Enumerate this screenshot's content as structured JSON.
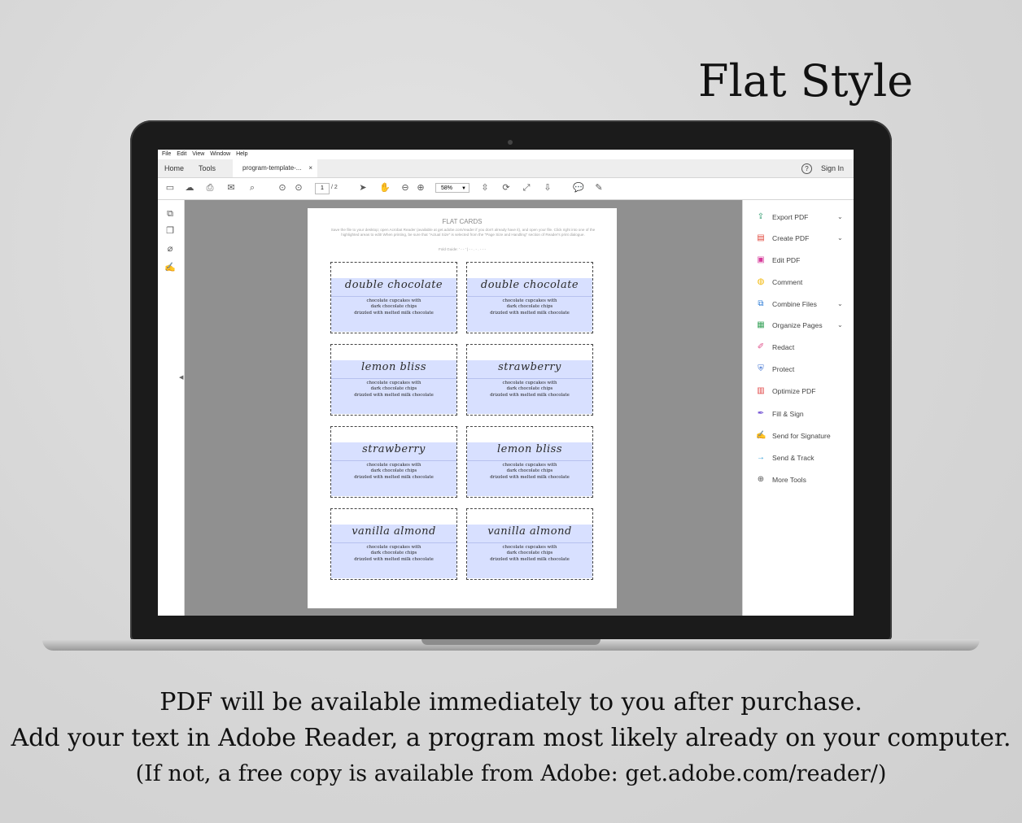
{
  "headline": "Flat Style",
  "menu": [
    "File",
    "Edit",
    "View",
    "Window",
    "Help"
  ],
  "tabs": {
    "home": "Home",
    "tools": "Tools",
    "document": "program-template-...",
    "close": "×"
  },
  "help_icon": "?",
  "sign_in": "Sign In",
  "toolbar": {
    "page_current": "1",
    "page_total": "/ 2",
    "zoom": "58%"
  },
  "document": {
    "title": "FLAT CARDS",
    "instructions": "Save the file to your desktop; open Acrobat Reader (available at get.adobe.com/reader if you don't already have it), and open your file. Click right into one of the highlighted areas to edit! When printing, be sure that \"Actual Size\" is selected from the \"Page Size and Handling\" section of Reader's print dialogue.",
    "fold_guide": "Fold Guide: ' - - ' | - - . - . - - -",
    "cards": [
      {
        "name": "double chocolate",
        "line1": "chocolate cupcakes with",
        "line2": "dark chocolate chips",
        "line3": "drizzled with melted milk chocolate"
      },
      {
        "name": "double chocolate",
        "line1": "chocolate cupcakes with",
        "line2": "dark chocolate chips",
        "line3": "drizzled with melted milk chocolate"
      },
      {
        "name": "lemon bliss",
        "line1": "chocolate cupcakes with",
        "line2": "dark chocolate chips",
        "line3": "drizzled with melted milk chocolate"
      },
      {
        "name": "strawberry",
        "line1": "chocolate cupcakes with",
        "line2": "dark chocolate chips",
        "line3": "drizzled with melted milk chocolate"
      },
      {
        "name": "strawberry",
        "line1": "chocolate cupcakes with",
        "line2": "dark chocolate chips",
        "line3": "drizzled with melted milk chocolate"
      },
      {
        "name": "lemon bliss",
        "line1": "chocolate cupcakes with",
        "line2": "dark chocolate chips",
        "line3": "drizzled with melted milk chocolate"
      },
      {
        "name": "vanilla almond",
        "line1": "chocolate cupcakes with",
        "line2": "dark chocolate chips",
        "line3": "drizzled with melted milk chocolate"
      },
      {
        "name": "vanilla almond",
        "line1": "chocolate cupcakes with",
        "line2": "dark chocolate chips",
        "line3": "drizzled with melted milk chocolate"
      }
    ]
  },
  "tools_panel": [
    {
      "label": "Export PDF",
      "icon": "export-pdf-icon",
      "color": "#2e9b6e",
      "dropdown": true
    },
    {
      "label": "Create PDF",
      "icon": "create-pdf-icon",
      "color": "#e0463a",
      "dropdown": true
    },
    {
      "label": "Edit PDF",
      "icon": "edit-pdf-icon",
      "color": "#d63a9a",
      "dropdown": false
    },
    {
      "label": "Comment",
      "icon": "comment-icon",
      "color": "#f2b600",
      "dropdown": false
    },
    {
      "label": "Combine Files",
      "icon": "combine-files-icon",
      "color": "#2a7ad6",
      "dropdown": true
    },
    {
      "label": "Organize Pages",
      "icon": "organize-pages-icon",
      "color": "#3aa35b",
      "dropdown": true
    },
    {
      "label": "Redact",
      "icon": "redact-icon",
      "color": "#e0508a",
      "dropdown": false
    },
    {
      "label": "Protect",
      "icon": "protect-icon",
      "color": "#3a6fd0",
      "dropdown": false
    },
    {
      "label": "Optimize PDF",
      "icon": "optimize-pdf-icon",
      "color": "#e04040",
      "dropdown": false
    },
    {
      "label": "Fill & Sign",
      "icon": "fill-sign-icon",
      "color": "#7a5bd6",
      "dropdown": false
    },
    {
      "label": "Send for Signature",
      "icon": "send-for-signature-icon",
      "color": "#6a4fc9",
      "dropdown": false
    },
    {
      "label": "Send & Track",
      "icon": "send-track-icon",
      "color": "#2a9bd6",
      "dropdown": false
    },
    {
      "label": "More Tools",
      "icon": "more-tools-icon",
      "color": "#555555",
      "dropdown": false
    }
  ],
  "captions": [
    "PDF will be available immediately to you after purchase.",
    "Add your text in Adobe Reader, a program most likely already on your computer.",
    "(If not, a free copy is available from Adobe: get.adobe.com/reader/)"
  ]
}
